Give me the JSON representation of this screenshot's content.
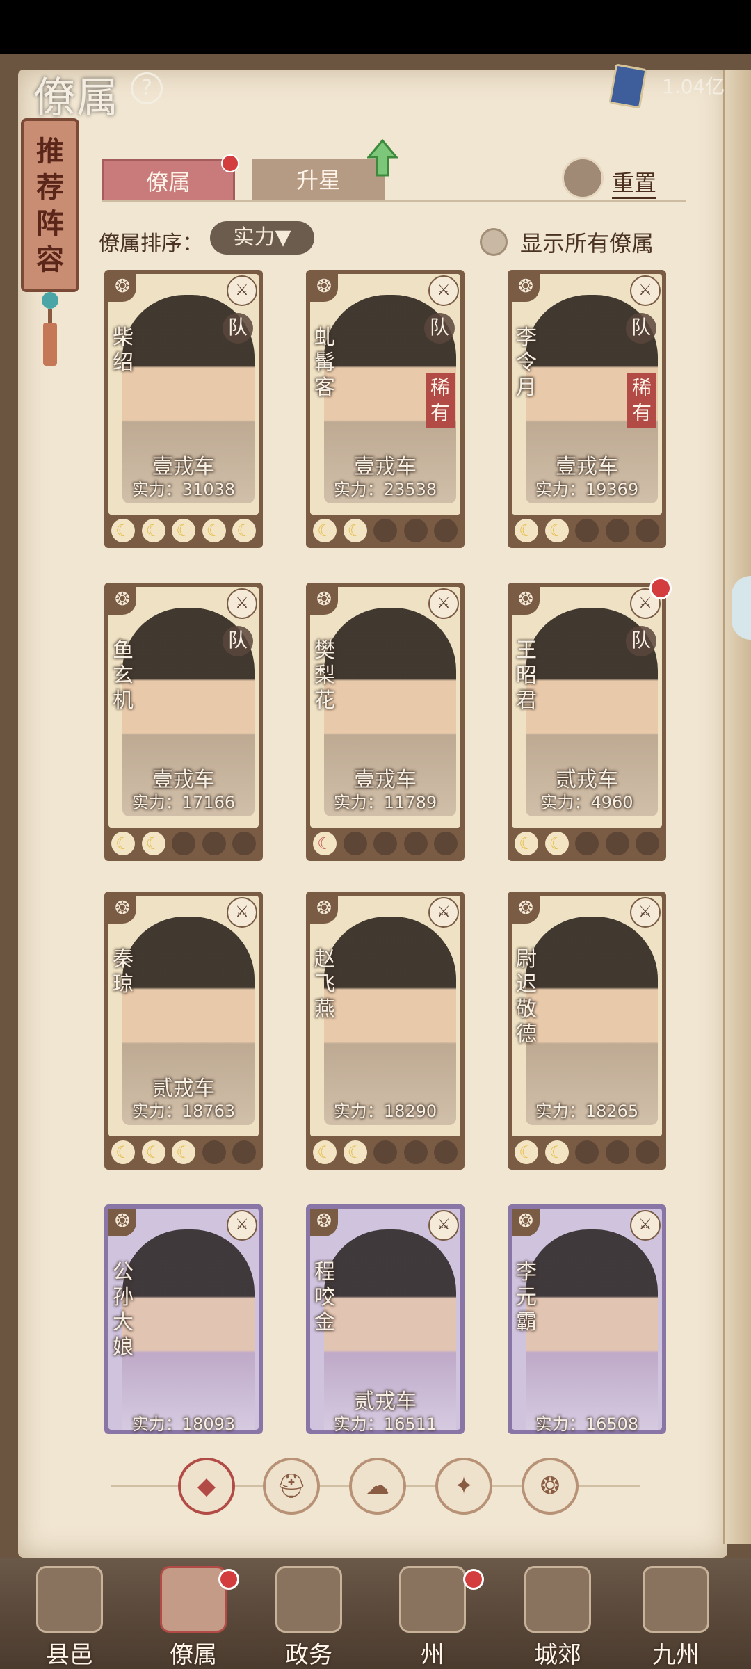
{
  "header": {
    "title": "僚属",
    "help_symbol": "?",
    "currency_value": "1.04亿"
  },
  "bookmark": {
    "label": "推荐阵容"
  },
  "tabs": [
    {
      "label": "僚属",
      "active": true
    },
    {
      "label": "升星",
      "active": false
    }
  ],
  "reset_label": "重置",
  "sort": {
    "label": "僚属排序：",
    "selected": "实力▼"
  },
  "show_all_label": "显示所有僚属",
  "cards": [
    {
      "name": "柴绍",
      "badge": "队",
      "rare": "",
      "rank": "壹戎车",
      "power": "实力：31038",
      "stars": 5,
      "style": "tan"
    },
    {
      "name": "虬髯客",
      "badge": "队",
      "rare": "稀有",
      "rank": "壹戎车",
      "power": "实力：23538",
      "stars": 2,
      "style": "tan"
    },
    {
      "name": "李令月",
      "badge": "队",
      "rare": "稀有",
      "rank": "壹戎车",
      "power": "实力：19369",
      "stars": 2,
      "style": "tan"
    },
    {
      "name": "鱼玄机",
      "badge": "队",
      "rare": "",
      "rank": "壹戎车",
      "power": "实力：17166",
      "stars": 2,
      "style": "tan"
    },
    {
      "name": "樊梨花",
      "badge": "",
      "rare": "",
      "rank": "壹戎车",
      "power": "实力：11789",
      "stars": 1,
      "style": "tan"
    },
    {
      "name": "王昭君",
      "badge": "队",
      "rare": "",
      "rank": "贰戎车",
      "power": "实力：4960",
      "stars": 2,
      "style": "tan"
    },
    {
      "name": "秦琼",
      "badge": "",
      "rare": "",
      "rank": "贰戎车",
      "power": "实力：18763",
      "stars": 3,
      "style": "tan"
    },
    {
      "name": "赵飞燕",
      "badge": "",
      "rare": "",
      "rank": "",
      "power": "实力：18290",
      "stars": 2,
      "style": "tan"
    },
    {
      "name": "尉迟敬德",
      "badge": "",
      "rare": "",
      "rank": "",
      "power": "实力：18265",
      "stars": 2,
      "style": "tan"
    },
    {
      "name": "公孙大娘",
      "badge": "",
      "rare": "",
      "rank": "",
      "power": "实力：18093",
      "stars": 0,
      "style": "purple"
    },
    {
      "name": "程咬金",
      "badge": "",
      "rare": "",
      "rank": "贰戎车",
      "power": "实力：16511",
      "stars": 0,
      "style": "purple"
    },
    {
      "name": "李元霸",
      "badge": "",
      "rare": "",
      "rank": "",
      "power": "实力：16508",
      "stars": 0,
      "style": "purple"
    }
  ],
  "nav": [
    {
      "label": "县邑",
      "active": false
    },
    {
      "label": "僚属",
      "active": true
    },
    {
      "label": "政务",
      "active": false
    },
    {
      "label": "州",
      "active": false
    },
    {
      "label": "城郊",
      "active": false
    },
    {
      "label": "九州",
      "active": false
    }
  ],
  "colors": {
    "accent_red": "#b24b45",
    "card_frame": "#7a5b44",
    "rare_purple": "#8a76a6"
  }
}
